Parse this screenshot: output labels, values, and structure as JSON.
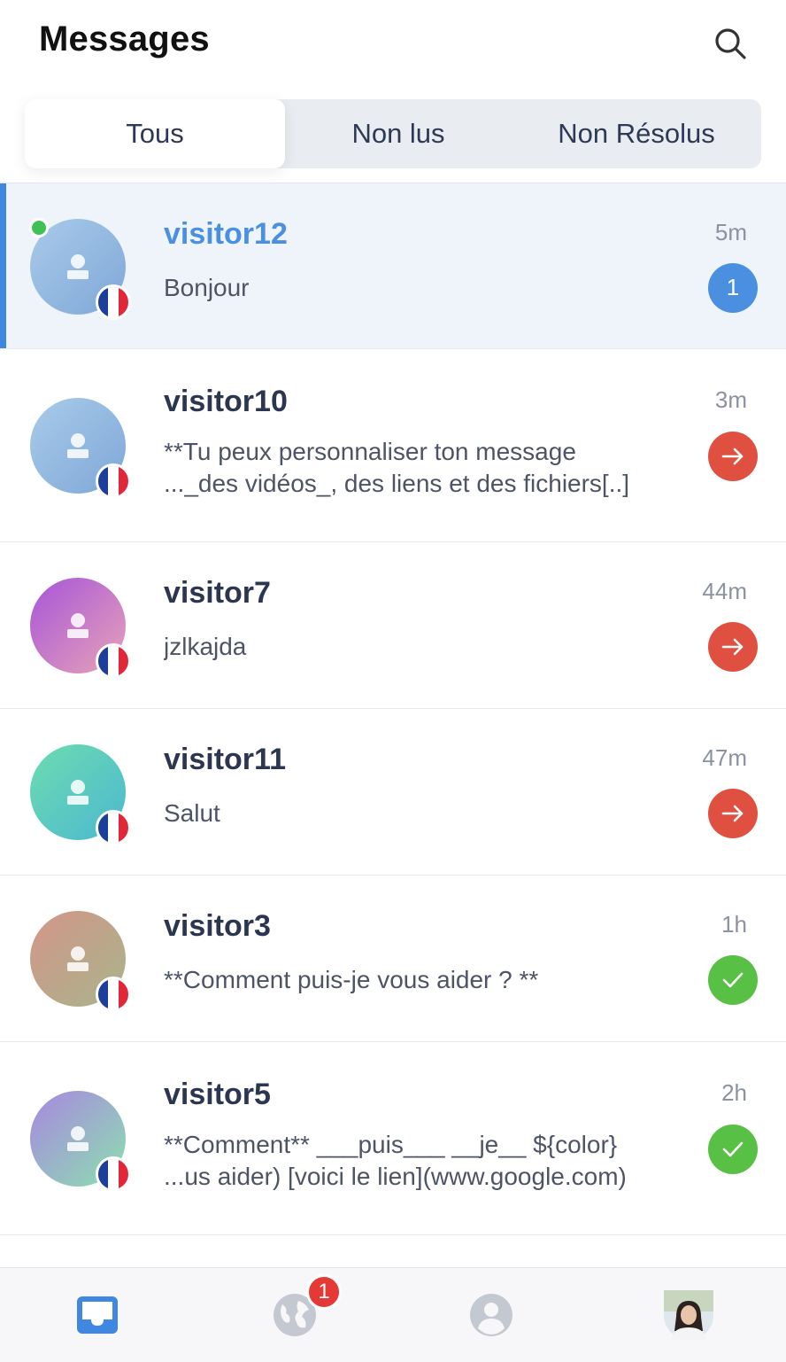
{
  "header": {
    "title": "Messages",
    "search_icon": "search-icon"
  },
  "tabs": [
    {
      "label": "Tous",
      "active": true
    },
    {
      "label": "Non lus",
      "active": false
    },
    {
      "label": "Non Résolus",
      "active": false
    }
  ],
  "conversations": [
    {
      "name": "visitor12",
      "preview_lines": [
        "Bonjour"
      ],
      "time": "5m",
      "status": "unread",
      "unread_count": "1",
      "online": true,
      "selected": true,
      "avatar_colors": [
        "#a9cbe9",
        "#7fa7d8"
      ],
      "flag": "france-flag-icon"
    },
    {
      "name": "visitor10",
      "preview_lines": [
        "**Tu peux personnaliser ton message",
        "..._des vidéos_, des liens et des fichiers[..]"
      ],
      "time": "3m",
      "status": "pending",
      "unread_count": "",
      "online": false,
      "selected": false,
      "avatar_colors": [
        "#a9cbe9",
        "#7fa7d8"
      ],
      "flag": "france-flag-icon"
    },
    {
      "name": "visitor7",
      "preview_lines": [
        "jzlkajda"
      ],
      "time": "44m",
      "status": "pending",
      "unread_count": "",
      "online": false,
      "selected": false,
      "avatar_colors": [
        "#a855d8",
        "#e6a3b8"
      ],
      "flag": "france-flag-icon"
    },
    {
      "name": "visitor11",
      "preview_lines": [
        "Salut"
      ],
      "time": "47m",
      "status": "pending",
      "unread_count": "",
      "online": false,
      "selected": false,
      "avatar_colors": [
        "#6ddcb0",
        "#4cb8d0"
      ],
      "flag": "france-flag-icon"
    },
    {
      "name": "visitor3",
      "preview_lines": [
        "**Comment puis-je vous aider ? **"
      ],
      "time": "1h",
      "status": "resolved",
      "unread_count": "",
      "online": false,
      "selected": false,
      "avatar_colors": [
        "#d39688",
        "#a8b48c"
      ],
      "flag": "france-flag-icon"
    },
    {
      "name": "visitor5",
      "preview_lines": [
        "**Comment** ___puis___ __je__ ${color}",
        "...us aider) [voici le lien](www.google.com)"
      ],
      "time": "2h",
      "status": "resolved",
      "unread_count": "",
      "online": false,
      "selected": false,
      "avatar_colors": [
        "#a887e0",
        "#8ce0b0"
      ],
      "flag": "france-flag-icon"
    }
  ],
  "tabbar": {
    "items": [
      "inbox-icon",
      "globe-icon",
      "contacts-icon",
      "profile-avatar"
    ],
    "globe_badge": "1"
  },
  "colors": {
    "accent": "#4a90e2",
    "unread": "#4a8fe0",
    "pending": "#e05040",
    "resolved": "#58c044",
    "online": "#3fc255"
  }
}
